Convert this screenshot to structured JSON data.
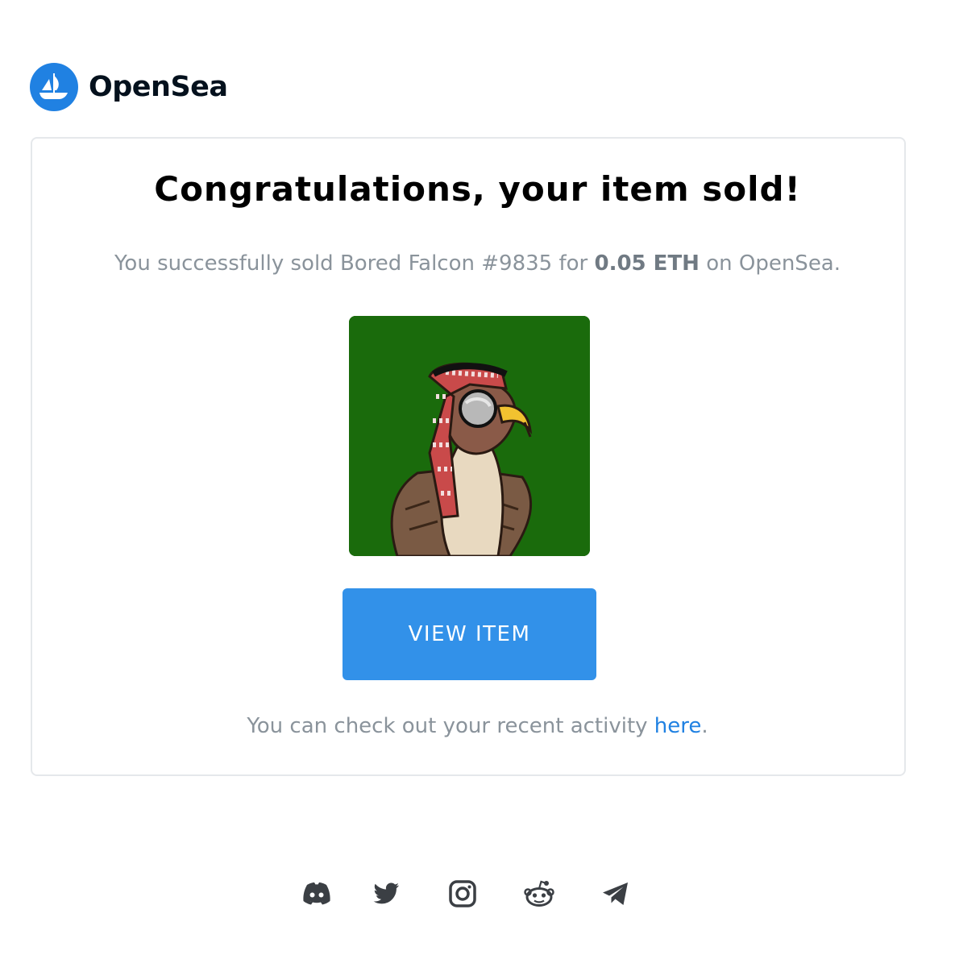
{
  "brand": {
    "name": "OpenSea",
    "logo_icon": "opensea-logo-icon",
    "color": "#2081e2"
  },
  "email": {
    "title": "Congratulations, your item sold!",
    "message": {
      "prefix": "You successfully sold Bored Falcon #9835 for ",
      "price": "0.05 ETH",
      "suffix": " on OpenSea."
    },
    "item_image": {
      "alt": "Bored Falcon #9835",
      "background_color": "#1a6b0c"
    },
    "view_button": {
      "label": "VIEW ITEM",
      "color": "#3291e9"
    },
    "activity": {
      "prefix": "You can check out your recent activity ",
      "link": "here",
      "suffix": "."
    }
  },
  "footer": {
    "social_icons": [
      "discord-icon",
      "twitter-icon",
      "instagram-icon",
      "reddit-icon",
      "telegram-icon"
    ]
  }
}
